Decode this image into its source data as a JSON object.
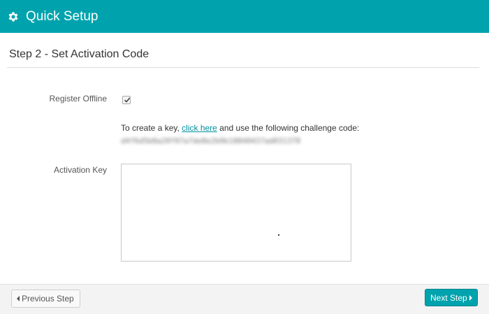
{
  "header": {
    "title": "Quick Setup",
    "icon": "gear-icon",
    "color": "#00a3ad"
  },
  "step": {
    "title": "Step 2 - Set Activation Code"
  },
  "form": {
    "offline_label": "Register Offline",
    "offline_checked": true,
    "help_prefix": "To create a key, ",
    "help_link": "click here",
    "help_suffix": " and use the following challenge code:",
    "challenge_code": "d4f6d5b8a20f07a7de8e2b9b18840437ad031378",
    "activation_label": "Activation Key",
    "activation_value": ""
  },
  "footer": {
    "prev_label": "Previous Step",
    "next_label": "Next Step"
  }
}
